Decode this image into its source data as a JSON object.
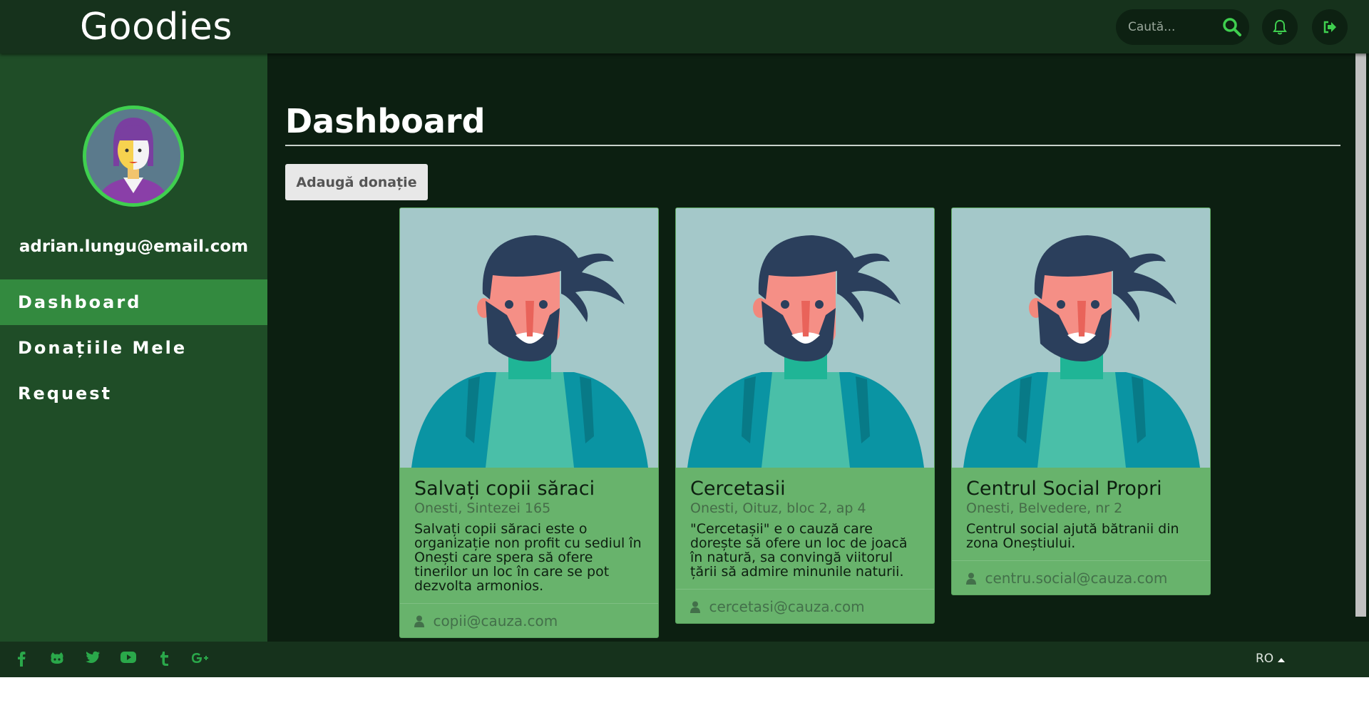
{
  "header": {
    "brand": "Goodies",
    "search_placeholder": "Caută..."
  },
  "sidebar": {
    "email": "adrian.lungu@email.com",
    "items": [
      {
        "label": "Dashboard",
        "active": true
      },
      {
        "label": "Donațiile Mele",
        "active": false
      },
      {
        "label": "Request",
        "active": false
      }
    ]
  },
  "main": {
    "title": "Dashboard",
    "add_button": "Adaugă donație",
    "cards": [
      {
        "title": "Salvați copii săraci",
        "address": "Onesti, Sintezei 165",
        "description": "Salvați copii săraci este o organizație non profit cu sediul în Onești care spera să ofere tinerilor un loc în care se pot dezvolta armonios.",
        "email": "copii@cauza.com"
      },
      {
        "title": "Cercetasii",
        "address": "Onesti, Oituz, bloc 2, ap 4",
        "description": "\"Cercetașii\" e o cauză care dorește să ofere un loc de joacă în natură, sa convingă viitorul țării să admire minunile naturii.",
        "email": "cercetasi@cauza.com"
      },
      {
        "title": "Centrul Social Propri",
        "address": "Onesti, Belvedere, nr 2",
        "description": "Centrul social ajută bătranii din zona Oneștiului.",
        "email": "centru.social@cauza.com"
      }
    ]
  },
  "footer": {
    "social_icons": [
      "facebook-icon",
      "github-icon",
      "twitter-icon",
      "youtube-icon",
      "tumblr-icon",
      "google-plus-icon"
    ],
    "language": "RO"
  },
  "colors": {
    "header_bg": "#16321c",
    "sidebar_bg": "#1f4d27",
    "active_nav": "#338a3f",
    "main_bg": "#0c1f11",
    "card_bg": "#68b36c",
    "accent": "#3fcf4f"
  }
}
